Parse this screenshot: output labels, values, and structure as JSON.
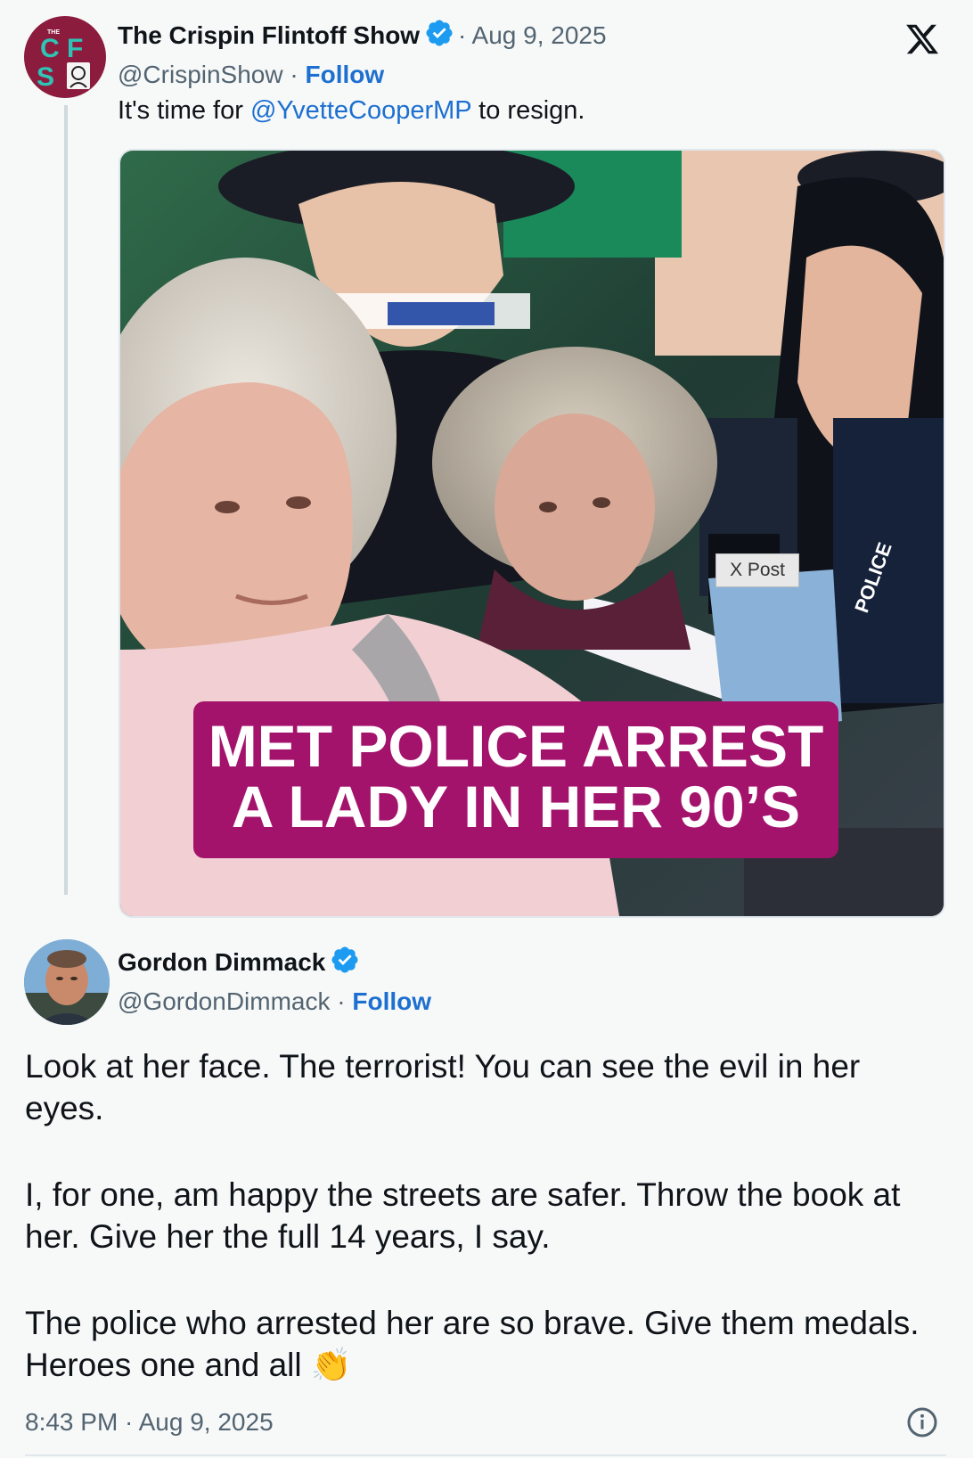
{
  "parent_tweet": {
    "author_name": "The Crispin Flintoff Show",
    "author_handle": "@CrispinShow",
    "avatar_text_top": "THE",
    "avatar_letters": [
      "C",
      "F",
      "S"
    ],
    "date": "Aug 9, 2025",
    "follow_label": "Follow",
    "text_before": "It's time for ",
    "mention": "@YvetteCooperMP",
    "text_after": " to resign.",
    "media_caption_line1": "MET POLICE ARREST",
    "media_caption_line2": "A LADY IN HER 90’S",
    "media_badge": "X Post",
    "media_vest_text": "POLICE"
  },
  "reply_tweet": {
    "author_name": "Gordon Dimmack",
    "author_handle": "@GordonDimmack",
    "follow_label": "Follow",
    "paragraph1": "Look at her face. The terrorist! You can see the evil in her eyes.",
    "paragraph2": "I, for one, am happy the streets are safer. Throw the book at her. Give her the full 14 years, I say.",
    "paragraph3_text": "The police who arrested her are so brave. Give them medals. Heroes one and all ",
    "paragraph3_emoji": "👏",
    "time": "8:43 PM",
    "date": "Aug 9, 2025"
  },
  "separator": " · ",
  "icons": [
    "x-logo-icon",
    "verified-badge-icon",
    "info-icon"
  ],
  "colors": {
    "link": "#1d6fd0",
    "verified": "#1d9bf0",
    "caption_bg": "#a3136c",
    "avatar_bg": "#8c1c3e",
    "avatar_letters": "#2ec4b6"
  }
}
